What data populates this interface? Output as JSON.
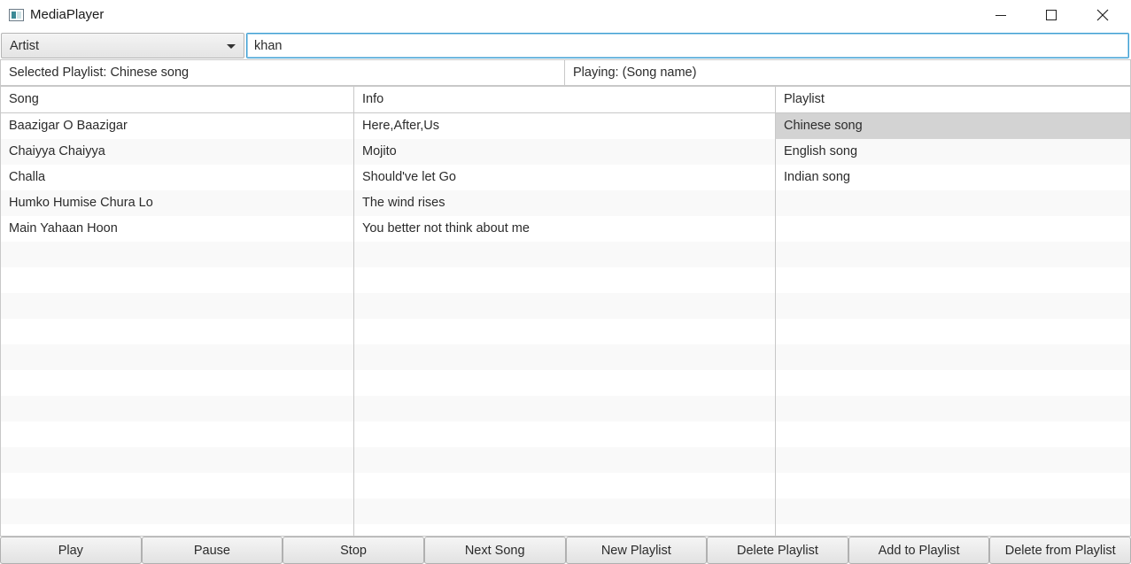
{
  "window": {
    "title": "MediaPlayer"
  },
  "search": {
    "filter_selected": "Artist",
    "query": "khan"
  },
  "status": {
    "selected_playlist": "Selected Playlist: Chinese song",
    "playing": "Playing: (Song name)"
  },
  "songs_table": {
    "header": "Song",
    "rows": [
      "Baazigar O Baazigar",
      "Chaiyya Chaiyya",
      "Challa",
      "Humko Humise Chura Lo",
      "Main Yahaan Hoon"
    ]
  },
  "info_table": {
    "header": "Info",
    "rows": [
      "Here,After,Us",
      "Mojito",
      "Should've let Go",
      "The wind rises",
      "You better not think about me"
    ]
  },
  "playlist_table": {
    "header": "Playlist",
    "rows": [
      "Chinese song",
      "English song",
      "Indian song"
    ],
    "selected_index": 0
  },
  "buttons": [
    "Play",
    "Pause",
    "Stop",
    "Next Song",
    "New Playlist",
    "Delete Playlist",
    "Add to Playlist",
    "Delete from Playlist"
  ]
}
